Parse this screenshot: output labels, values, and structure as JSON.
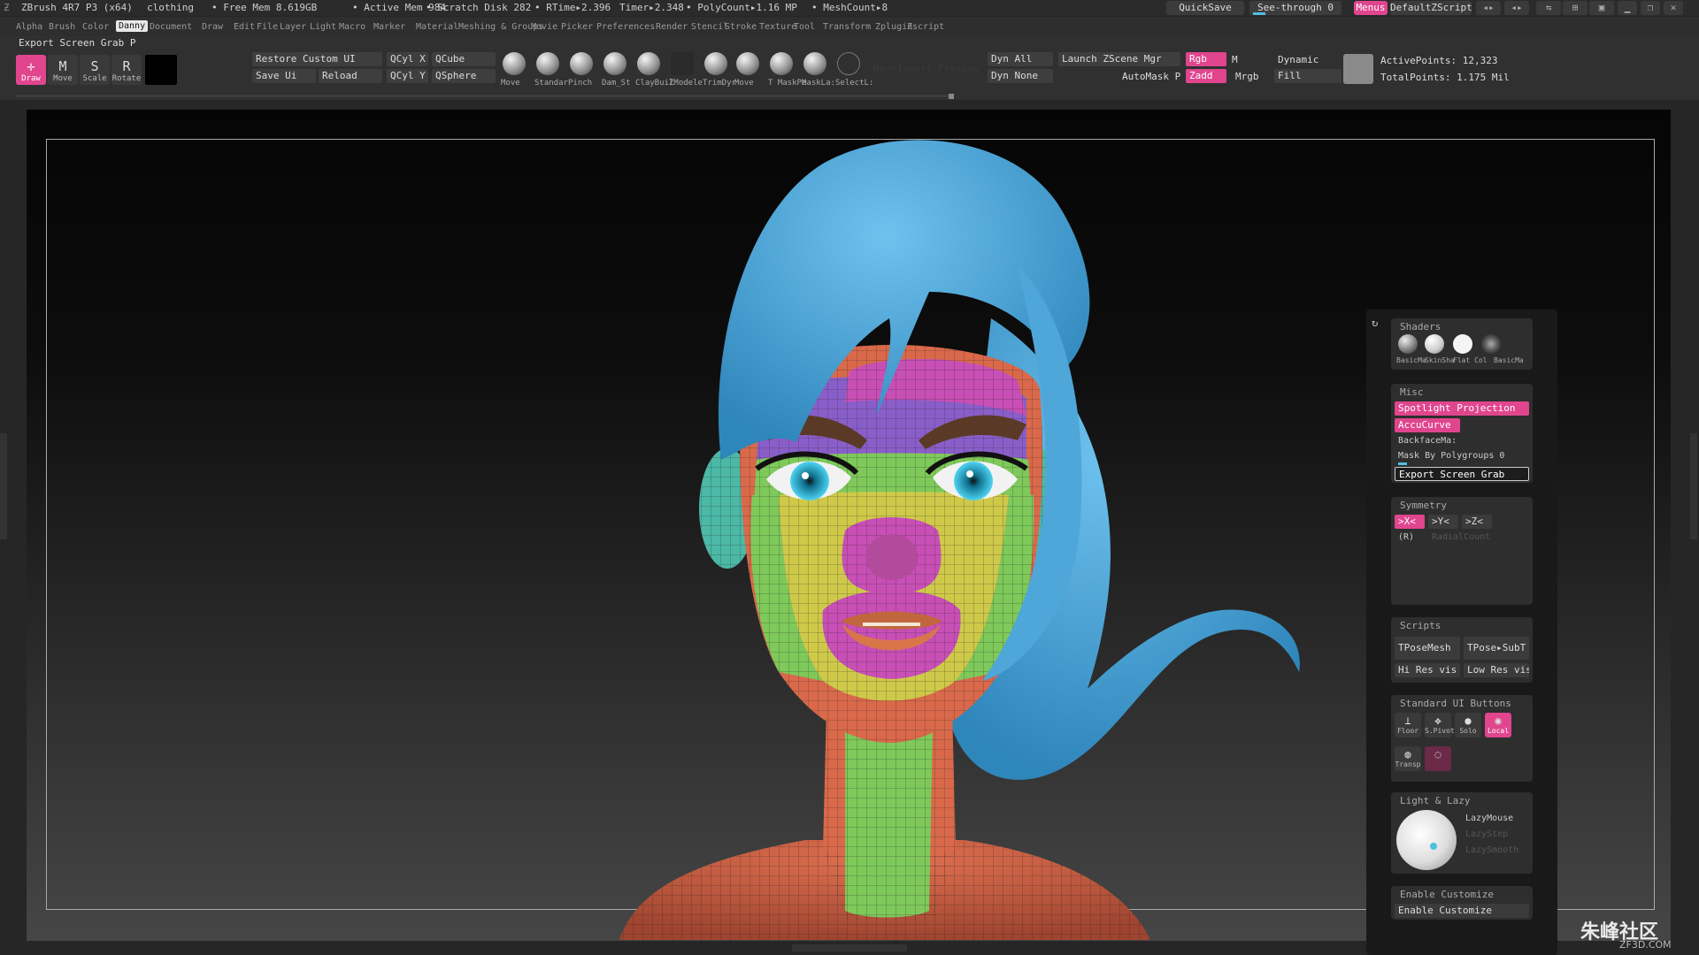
{
  "titlebar": {
    "app": "ZBrush 4R7 P3 (x64)",
    "doc": "clothing",
    "free_mem": "• Free Mem 8.619GB",
    "active_mem": "• Active Mem 984",
    "scratch": "• Scratch Disk 282",
    "rtime": "• RTime▸2.396",
    "timer": "Timer▸2.348",
    "polycount": "• PolyCount▸1.16 MP",
    "meshcount": "• MeshCount▸8",
    "quicksave": "QuickSave",
    "seethrough": "See-through  0",
    "menus": "Menus",
    "script": "DefaultZScript"
  },
  "menubar": {
    "items": [
      "Alpha",
      "Brush",
      "Color",
      "Danny",
      "Document",
      "Draw",
      "Edit",
      "File",
      "Layer",
      "Light",
      "Macro",
      "Marker",
      "Material",
      "Meshing & Groups",
      "Movie",
      "Picker",
      "Preferences",
      "Render",
      "Stencil",
      "Stroke",
      "Texture",
      "Tool",
      "Transform",
      "Zplugin",
      "Zscript"
    ],
    "selected_index": 3
  },
  "toolbar": {
    "export_title": "Export Screen Grab  P",
    "tools": [
      {
        "label": "Draw",
        "glyph": "✛"
      },
      {
        "label": "Move",
        "glyph": "M"
      },
      {
        "label": "Scale",
        "glyph": "S"
      },
      {
        "label": "Rotate",
        "glyph": "R"
      }
    ],
    "restore_custom_ui": "Restore Custom UI",
    "save_ui": "Save Ui",
    "reload": "Reload",
    "qcyl_x": "QCyl X",
    "qcyl_y": "QCyl Y",
    "qcube": "QCube",
    "qsphere": "QSphere",
    "brushes": [
      "Move",
      "Standar",
      "Pinch",
      "Dam_St",
      "ClayBuil",
      "ZModele",
      "TrimDyr",
      "Move",
      "T MaskPe",
      "MaskLa:",
      "SelectL:"
    ],
    "meshinsert_preview": "MeshInsert Preview",
    "dyn_all": "Dyn All",
    "dyn_none": "Dyn None",
    "launch_zscene": "Launch ZScene Mgr",
    "automask": "AutoMask P",
    "rgb": "Rgb",
    "m": "M",
    "zadd": "Zadd",
    "mrgb": "Mrgb",
    "dynamic": "Dynamic",
    "fill": "Fill",
    "active_points": "ActivePoints: 12,323",
    "total_points": "TotalPoints: 1.175  Mil"
  },
  "panel": {
    "shaders": {
      "title": "Shaders",
      "items": [
        "BasicMa",
        "SkinSha",
        "Flat Col",
        "BasicMa"
      ]
    },
    "misc": {
      "title": "Misc",
      "spotlight": "Spotlight Projection",
      "accucurve": "AccuCurve",
      "backface": "BackfaceMa:",
      "mask_polygroups": "Mask By Polygroups 0",
      "export_grab": "Export Screen Grab"
    },
    "symmetry": {
      "title": "Symmetry",
      "x": ">X<",
      "y": ">Y<",
      "z": ">Z<",
      "r": "(R)",
      "radial": "RadialCount"
    },
    "scripts": {
      "title": "Scripts",
      "tpose_mesh": "TPoseMesh",
      "tpose_subt": "TPose▸SubT",
      "hi_res": "Hi Res vis",
      "low_res": "Low Res vis"
    },
    "standard_ui": {
      "title": "Standard UI Buttons",
      "floor": "Floor",
      "spivot": "S.Pivot",
      "solo": "Solo",
      "local": "Local",
      "transp": "Transp"
    },
    "light_lazy": {
      "title": "Light & Lazy",
      "lazymouse": "LazyMouse",
      "lazystep": "LazyStep",
      "lazysmooth": "LazySmooth"
    },
    "enable_customize_title": "Enable Customize",
    "enable_customize_btn": "Enable Customize"
  },
  "watermark": {
    "main": "朱峰社区",
    "sub": "ZF3D.COM"
  },
  "colors": {
    "accent": "#e0458e",
    "hair": "#4fa6d8",
    "skin": "#d9694a"
  }
}
